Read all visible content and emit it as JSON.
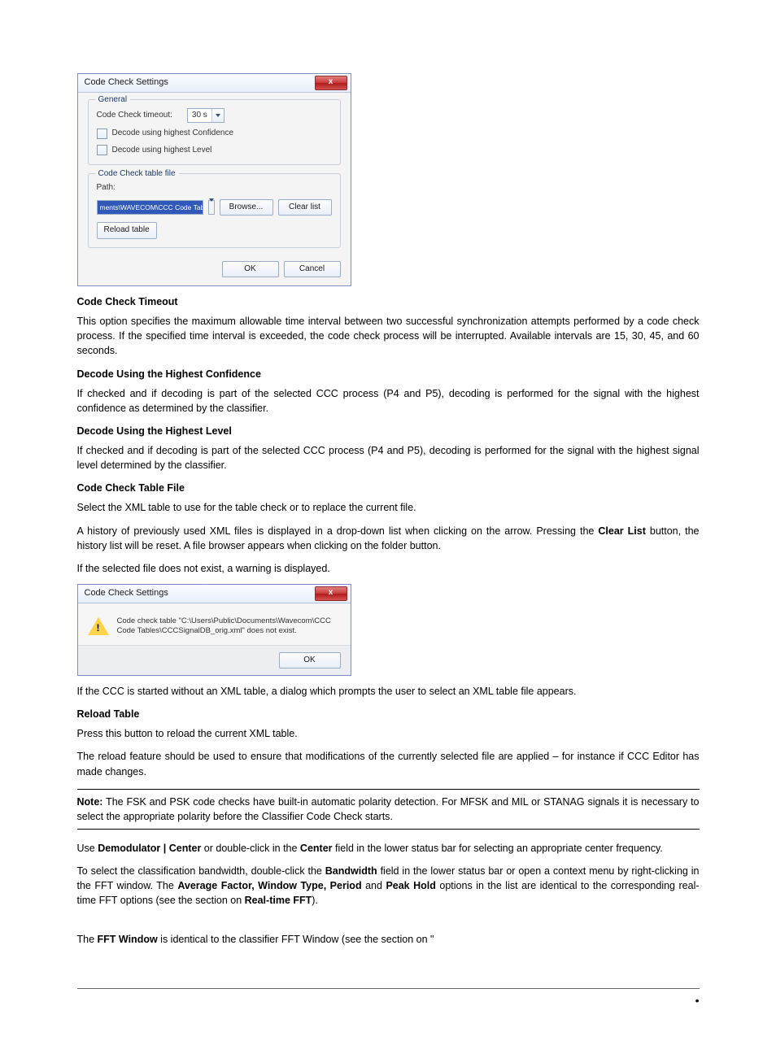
{
  "dialog1": {
    "title": "Code Check Settings",
    "close": "x",
    "group_general": {
      "title": "General",
      "timeout_label": "Code Check timeout:",
      "timeout_value": "30 s",
      "chk1": "Decode using highest Confidence",
      "chk2": "Decode using highest Level"
    },
    "group_table": {
      "title": "Code Check table file",
      "path_label": "Path:",
      "path_value": "ments\\WAVECOM\\CCC Code Tables\\CCCSignalDB.xml",
      "browse": "Browse...",
      "clear": "Clear list",
      "reload": "Reload table"
    },
    "ok": "OK",
    "cancel": "Cancel"
  },
  "headings": {
    "h1": "Code Check Timeout",
    "h2": "Decode Using the Highest Confidence",
    "h3": "Decode Using the Highest Level",
    "h4": "Code Check Table File",
    "h5": "Reload Table"
  },
  "paras": {
    "p1": "This option specifies the maximum allowable time interval between two successful synchronization attempts performed by a code check process. If the specified time interval is exceeded, the code check process will be interrupted. Available intervals are 15, 30, 45, and 60 seconds.",
    "p2": "If checked and if decoding is part of the selected CCC process (P4 and P5), decoding is performed for the signal with the highest confidence as determined by the classifier.",
    "p3": "If checked and if decoding is part of the selected CCC process (P4 and P5), decoding is performed for the signal with the highest signal level determined by the classifier.",
    "p4": "Select the XML table to use for the table check or to replace the current file.",
    "p5a": "A history of previously used XML files is displayed in a drop-down list when clicking on the arrow. Pressing the ",
    "p5b": "Clear List",
    "p5c": " button, the history list will be reset. A file browser appears when clicking on the folder button.",
    "p6": "If the selected file does not exist, a warning is displayed.",
    "p7": "If the CCC is started without an XML table, a dialog which prompts the user to select an XML table file appears.",
    "p8": "Press this button to reload the current XML table.",
    "p9": "The reload feature should be used to ensure that modifications of the currently selected file are applied – for instance if CCC Editor has made changes.",
    "note_a": "Note:",
    "note_b": " The FSK and PSK code checks have built-in automatic polarity detection. For MFSK and MIL or STANAG signals it is necessary to select the appropriate polarity before the Classifier Code Check starts.",
    "p10a": "Use ",
    "p10b": "Demodulator | Center",
    "p10c": " or double-click in the ",
    "p10d": "Center",
    "p10e": " field in the lower status bar for selecting an appropriate center frequency.",
    "p11a": "To select the classification bandwidth, double-click the ",
    "p11b": "Bandwidth",
    "p11c": " field in the lower status bar or open a context menu by right-clicking in the FFT window. The ",
    "p11d": "Average Factor, Window Type, Period",
    "p11e": " and ",
    "p11f": "Peak Hold",
    "p11g": " options in the list are identical to the corresponding real-time FFT options (see the section on ",
    "p11h": "Real-time FFT",
    "p11i": ").",
    "p12a": "The ",
    "p12b": "FFT Window",
    "p12c": " is identical to the classifier FFT Window (see the section on \""
  },
  "dialog2": {
    "title": "Code Check Settings",
    "close": "x",
    "msg": "Code check table \"C:\\Users\\Public\\Documents\\Wavecom\\CCC Code Tables\\CCCSignalDB_orig.xml\" does not exist.",
    "ok": "OK"
  },
  "footer_dot": "•"
}
